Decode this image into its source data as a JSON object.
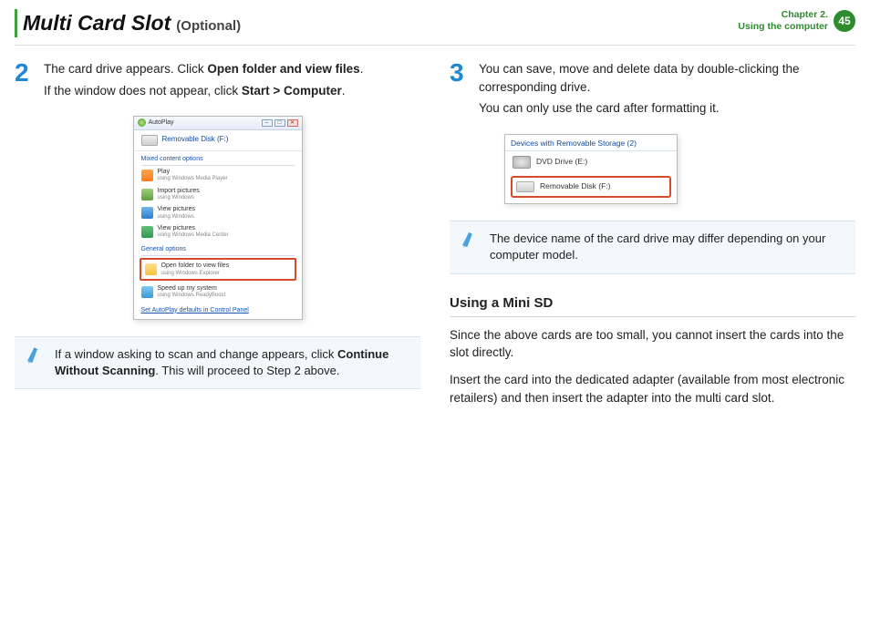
{
  "header": {
    "title_main": "Multi Card Slot",
    "title_sub": "(Optional)",
    "chapter_line": "Chapter 2.",
    "section_line": "Using the computer",
    "page_number": "45"
  },
  "left": {
    "step2": {
      "num": "2",
      "line1_pre": "The card drive appears. Click ",
      "line1_bold": "Open folder and view files",
      "line1_post": ".",
      "line2_pre": "If the window does not appear, click ",
      "line2_bold": "Start > Computer",
      "line2_post": "."
    },
    "autoplay": {
      "title": "AutoPlay",
      "drive": "Removable Disk (F:)",
      "mixed_label": "Mixed content options",
      "items": [
        {
          "title": "Play",
          "sub": "using Windows Media Player"
        },
        {
          "title": "Import pictures",
          "sub": "using Windows"
        },
        {
          "title": "View pictures",
          "sub": "using Windows"
        },
        {
          "title": "View pictures",
          "sub": "using Windows Media Center"
        }
      ],
      "general_label": "General options",
      "highlight": {
        "title": "Open folder to view files",
        "sub": "using Windows Explorer"
      },
      "speed": {
        "title": "Speed up my system",
        "sub": "using Windows ReadyBoost"
      },
      "footer_link": "Set AutoPlay defaults in Control Panel"
    },
    "note": {
      "pre": "If a window asking to scan and change appears, click ",
      "bold": "Continue Without Scanning",
      "post": ". This will proceed to Step 2 above."
    }
  },
  "right": {
    "step3": {
      "num": "3",
      "line1": "You can save, move and delete data by double-clicking the corresponding drive.",
      "line2": "You can only use the card after formatting it."
    },
    "devices": {
      "header": "Devices with Removable Storage (2)",
      "dvd": "DVD Drive (E:)",
      "removable": "Removable Disk (F:)"
    },
    "note": {
      "text": "The device name of the card drive may differ depending on your computer model."
    },
    "minisd": {
      "heading": "Using a Mini SD",
      "p1": "Since the above cards are too small, you cannot insert the cards into the slot directly.",
      "p2": "Insert the card into the dedicated adapter (available from most electronic retailers) and then insert the adapter into the multi card slot."
    }
  }
}
